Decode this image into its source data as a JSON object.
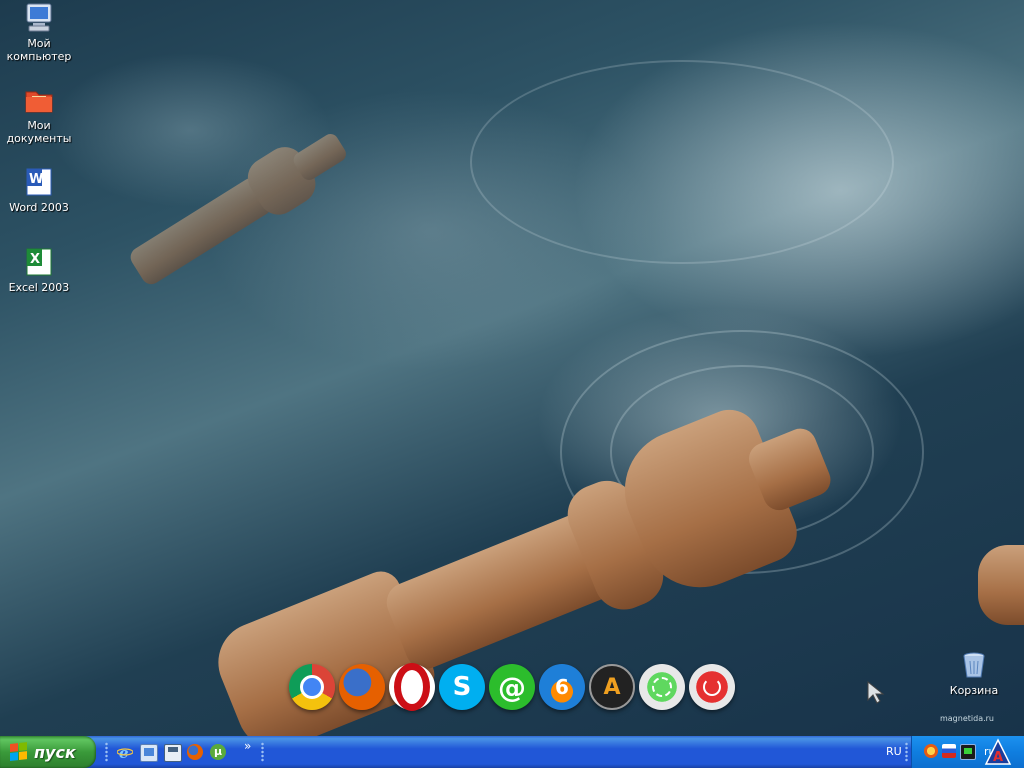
{
  "desktop": {
    "icons": [
      {
        "name": "my-computer",
        "label_line1": "Мой",
        "label_line2": "компьютер"
      },
      {
        "name": "my-documents",
        "label_line1": "Мои",
        "label_line2": "документы"
      },
      {
        "name": "word",
        "label_line1": "Word 2003",
        "label_line2": ""
      },
      {
        "name": "excel",
        "label_line1": "Excel 2003",
        "label_line2": ""
      },
      {
        "name": "recycle-bin",
        "label_line1": "Корзина",
        "label_line2": ""
      }
    ],
    "watermark": "magnetida.ru"
  },
  "dock": {
    "items": [
      {
        "name": "chrome-icon",
        "color": "#db4437"
      },
      {
        "name": "firefox-icon",
        "color": "#e66000"
      },
      {
        "name": "opera-icon",
        "color": "#cc0f16"
      },
      {
        "name": "skype-icon",
        "color": "#00aff0",
        "glyph": "S"
      },
      {
        "name": "mail-agent-icon",
        "color": "#2cbd2c",
        "glyph": "@"
      },
      {
        "name": "nero-burn-icon",
        "color": "#1e7fd8",
        "glyph": "6"
      },
      {
        "name": "aimp-icon",
        "color": "#f0a020",
        "glyph": "A"
      },
      {
        "name": "restart-icon",
        "color": "#38b838"
      },
      {
        "name": "shutdown-icon",
        "color": "#d82020"
      }
    ]
  },
  "taskbar": {
    "start_label": "пуск",
    "quick_launch": [
      "ie-icon",
      "show-desktop-icon",
      "save-icon",
      "firefox-icon",
      "utorrent-icon"
    ],
    "overflow_label": "»",
    "language": "RU",
    "tray_icons": [
      "antivirus-icon",
      "flag-icon",
      "network-icon"
    ],
    "clock": "ru"
  }
}
